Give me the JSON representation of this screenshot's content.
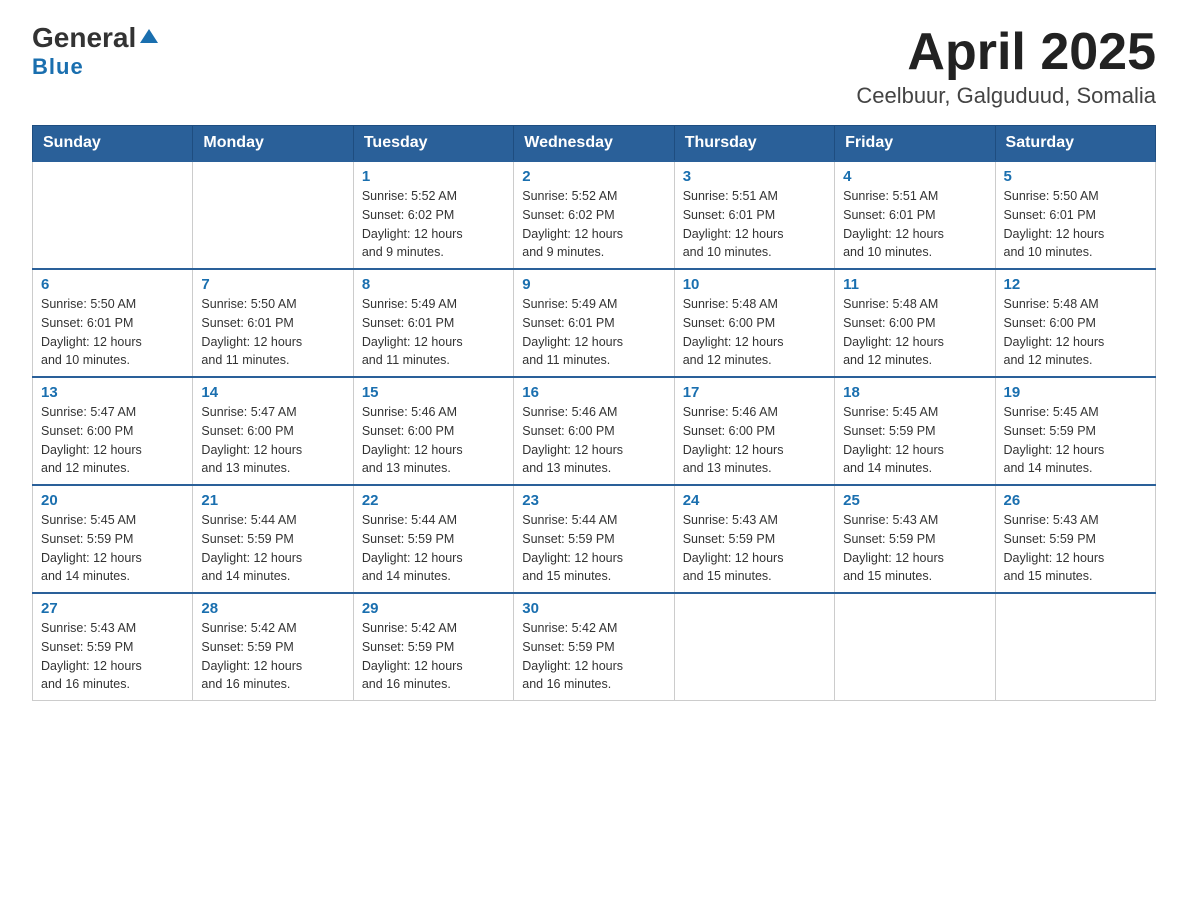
{
  "header": {
    "logo_general": "General",
    "logo_blue": "Blue",
    "title": "April 2025",
    "subtitle": "Ceelbuur, Galguduud, Somalia"
  },
  "days_of_week": [
    "Sunday",
    "Monday",
    "Tuesday",
    "Wednesday",
    "Thursday",
    "Friday",
    "Saturday"
  ],
  "weeks": [
    [
      {
        "day": "",
        "info": ""
      },
      {
        "day": "",
        "info": ""
      },
      {
        "day": "1",
        "sunrise": "5:52 AM",
        "sunset": "6:02 PM",
        "daylight": "12 hours and 9 minutes."
      },
      {
        "day": "2",
        "sunrise": "5:52 AM",
        "sunset": "6:02 PM",
        "daylight": "12 hours and 9 minutes."
      },
      {
        "day": "3",
        "sunrise": "5:51 AM",
        "sunset": "6:01 PM",
        "daylight": "12 hours and 10 minutes."
      },
      {
        "day": "4",
        "sunrise": "5:51 AM",
        "sunset": "6:01 PM",
        "daylight": "12 hours and 10 minutes."
      },
      {
        "day": "5",
        "sunrise": "5:50 AM",
        "sunset": "6:01 PM",
        "daylight": "12 hours and 10 minutes."
      }
    ],
    [
      {
        "day": "6",
        "sunrise": "5:50 AM",
        "sunset": "6:01 PM",
        "daylight": "12 hours and 10 minutes."
      },
      {
        "day": "7",
        "sunrise": "5:50 AM",
        "sunset": "6:01 PM",
        "daylight": "12 hours and 11 minutes."
      },
      {
        "day": "8",
        "sunrise": "5:49 AM",
        "sunset": "6:01 PM",
        "daylight": "12 hours and 11 minutes."
      },
      {
        "day": "9",
        "sunrise": "5:49 AM",
        "sunset": "6:01 PM",
        "daylight": "12 hours and 11 minutes."
      },
      {
        "day": "10",
        "sunrise": "5:48 AM",
        "sunset": "6:00 PM",
        "daylight": "12 hours and 12 minutes."
      },
      {
        "day": "11",
        "sunrise": "5:48 AM",
        "sunset": "6:00 PM",
        "daylight": "12 hours and 12 minutes."
      },
      {
        "day": "12",
        "sunrise": "5:48 AM",
        "sunset": "6:00 PM",
        "daylight": "12 hours and 12 minutes."
      }
    ],
    [
      {
        "day": "13",
        "sunrise": "5:47 AM",
        "sunset": "6:00 PM",
        "daylight": "12 hours and 12 minutes."
      },
      {
        "day": "14",
        "sunrise": "5:47 AM",
        "sunset": "6:00 PM",
        "daylight": "12 hours and 13 minutes."
      },
      {
        "day": "15",
        "sunrise": "5:46 AM",
        "sunset": "6:00 PM",
        "daylight": "12 hours and 13 minutes."
      },
      {
        "day": "16",
        "sunrise": "5:46 AM",
        "sunset": "6:00 PM",
        "daylight": "12 hours and 13 minutes."
      },
      {
        "day": "17",
        "sunrise": "5:46 AM",
        "sunset": "6:00 PM",
        "daylight": "12 hours and 13 minutes."
      },
      {
        "day": "18",
        "sunrise": "5:45 AM",
        "sunset": "5:59 PM",
        "daylight": "12 hours and 14 minutes."
      },
      {
        "day": "19",
        "sunrise": "5:45 AM",
        "sunset": "5:59 PM",
        "daylight": "12 hours and 14 minutes."
      }
    ],
    [
      {
        "day": "20",
        "sunrise": "5:45 AM",
        "sunset": "5:59 PM",
        "daylight": "12 hours and 14 minutes."
      },
      {
        "day": "21",
        "sunrise": "5:44 AM",
        "sunset": "5:59 PM",
        "daylight": "12 hours and 14 minutes."
      },
      {
        "day": "22",
        "sunrise": "5:44 AM",
        "sunset": "5:59 PM",
        "daylight": "12 hours and 14 minutes."
      },
      {
        "day": "23",
        "sunrise": "5:44 AM",
        "sunset": "5:59 PM",
        "daylight": "12 hours and 15 minutes."
      },
      {
        "day": "24",
        "sunrise": "5:43 AM",
        "sunset": "5:59 PM",
        "daylight": "12 hours and 15 minutes."
      },
      {
        "day": "25",
        "sunrise": "5:43 AM",
        "sunset": "5:59 PM",
        "daylight": "12 hours and 15 minutes."
      },
      {
        "day": "26",
        "sunrise": "5:43 AM",
        "sunset": "5:59 PM",
        "daylight": "12 hours and 15 minutes."
      }
    ],
    [
      {
        "day": "27",
        "sunrise": "5:43 AM",
        "sunset": "5:59 PM",
        "daylight": "12 hours and 16 minutes."
      },
      {
        "day": "28",
        "sunrise": "5:42 AM",
        "sunset": "5:59 PM",
        "daylight": "12 hours and 16 minutes."
      },
      {
        "day": "29",
        "sunrise": "5:42 AM",
        "sunset": "5:59 PM",
        "daylight": "12 hours and 16 minutes."
      },
      {
        "day": "30",
        "sunrise": "5:42 AM",
        "sunset": "5:59 PM",
        "daylight": "12 hours and 16 minutes."
      },
      {
        "day": "",
        "info": ""
      },
      {
        "day": "",
        "info": ""
      },
      {
        "day": "",
        "info": ""
      }
    ]
  ],
  "labels": {
    "sunrise": "Sunrise: ",
    "sunset": "Sunset: ",
    "daylight": "Daylight: "
  }
}
